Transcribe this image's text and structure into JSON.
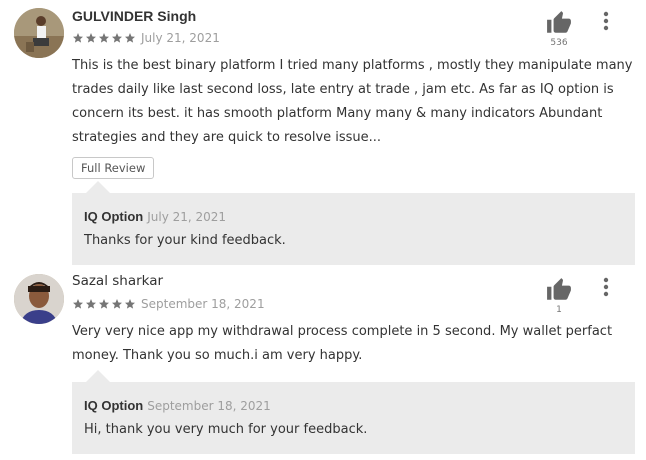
{
  "reviews": [
    {
      "author": "GULVINDER Singh",
      "rating": 5,
      "date": "July 21, 2021",
      "text": "This is the best binary platform I tried many platforms , mostly they manipulate many trades daily like last second loss, late entry at trade , jam etc. As far as IQ option is concern its best. it has smooth platform Many many & many indicators Abundant strategies and they are quick to resolve issue...",
      "helpful_count": "536",
      "full_review_label": "Full Review",
      "reply": {
        "developer": "IQ Option",
        "date": "July 21, 2021",
        "text": "Thanks for your kind feedback."
      }
    },
    {
      "author": "Sazal sharkar",
      "rating": 5,
      "date": "September 18, 2021",
      "text": "Very very nice app my withdrawal process complete in 5 second. My wallet perfact money. Thank you so much.i am very happy.",
      "helpful_count": "1",
      "reply": {
        "developer": "IQ Option",
        "date": "September 18, 2021",
        "text": "Hi, thank you very much for your feedback."
      }
    }
  ],
  "icons": {
    "helpful": "thumbs-up-icon",
    "more": "more-vert-icon",
    "star": "star-icon"
  },
  "colors": {
    "star": "#757575",
    "reply_bg": "#ebebeb",
    "date": "#9e9e9e",
    "icon": "#666666"
  }
}
